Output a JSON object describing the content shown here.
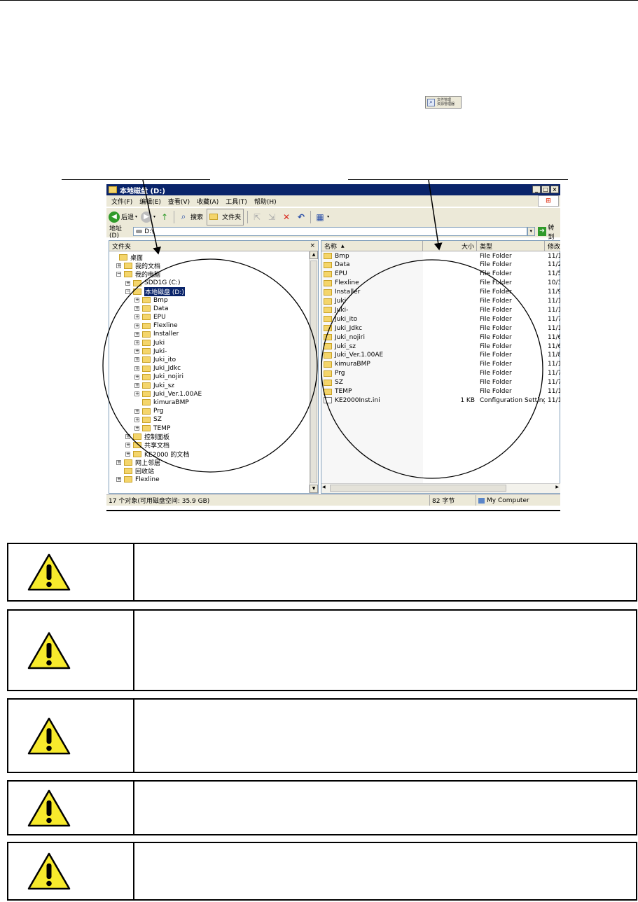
{
  "icon_button": {
    "line1": "文件管理",
    "line2": "资源管理器"
  },
  "window": {
    "title": "本地磁盘 (D:)",
    "menu": [
      "文件(F)",
      "编辑(E)",
      "查看(V)",
      "收藏(A)",
      "工具(T)",
      "帮助(H)"
    ],
    "toolbar": {
      "back": "后退",
      "search": "搜索",
      "folders": "文件夹"
    },
    "address": {
      "label": "地址(D)",
      "value": "D:\\",
      "go": "转到"
    },
    "left_pane": {
      "header": "文件夹",
      "close": "×",
      "tree": [
        {
          "label": "桌面",
          "level": 0,
          "expander": ""
        },
        {
          "label": "我的文档",
          "level": 1,
          "expander": "+"
        },
        {
          "label": "我的电脑",
          "level": 1,
          "expander": "−"
        },
        {
          "label": "SDD1G (C:)",
          "level": 2,
          "expander": "+"
        },
        {
          "label": "本地磁盘 (D:)",
          "level": 2,
          "expander": "−",
          "selected": true
        },
        {
          "label": "Bmp",
          "level": 3,
          "expander": "+"
        },
        {
          "label": "Data",
          "level": 3,
          "expander": "+"
        },
        {
          "label": "EPU",
          "level": 3,
          "expander": "+"
        },
        {
          "label": "Flexline",
          "level": 3,
          "expander": "+"
        },
        {
          "label": "Installer",
          "level": 3,
          "expander": "+"
        },
        {
          "label": "Juki",
          "level": 3,
          "expander": "+"
        },
        {
          "label": "Juki-",
          "level": 3,
          "expander": "+"
        },
        {
          "label": "Juki_ito",
          "level": 3,
          "expander": "+"
        },
        {
          "label": "Juki_Jdkc",
          "level": 3,
          "expander": "+"
        },
        {
          "label": "Juki_nojiri",
          "level": 3,
          "expander": "+"
        },
        {
          "label": "Juki_sz",
          "level": 3,
          "expander": "+"
        },
        {
          "label": "Juki_Ver.1.00AE",
          "level": 3,
          "expander": "+"
        },
        {
          "label": "kimuraBMP",
          "level": 3,
          "expander": ""
        },
        {
          "label": "Prg",
          "level": 3,
          "expander": "+"
        },
        {
          "label": "SZ",
          "level": 3,
          "expander": "+"
        },
        {
          "label": "TEMP",
          "level": 3,
          "expander": "+"
        },
        {
          "label": "控制面板",
          "level": 2,
          "expander": "+"
        },
        {
          "label": "共享文档",
          "level": 2,
          "expander": "+"
        },
        {
          "label": "KE2000 的文档",
          "level": 2,
          "expander": "+"
        },
        {
          "label": "网上邻居",
          "level": 1,
          "expander": "+"
        },
        {
          "label": "回收站",
          "level": 1,
          "expander": ""
        },
        {
          "label": "Flexline",
          "level": 1,
          "expander": "+"
        }
      ]
    },
    "right_pane": {
      "columns": [
        "名称",
        "大小",
        "类型",
        "修改"
      ],
      "rows": [
        {
          "name": "Bmp",
          "size": "",
          "type": "File Folder",
          "date": "11/1"
        },
        {
          "name": "Data",
          "size": "",
          "type": "File Folder",
          "date": "11/2"
        },
        {
          "name": "EPU",
          "size": "",
          "type": "File Folder",
          "date": "11/5"
        },
        {
          "name": "Flexline",
          "size": "",
          "type": "File Folder",
          "date": "10/3"
        },
        {
          "name": "Installer",
          "size": "",
          "type": "File Folder",
          "date": "11/9"
        },
        {
          "name": "Juki",
          "size": "",
          "type": "File Folder",
          "date": "11/1"
        },
        {
          "name": "Juki-",
          "size": "",
          "type": "File Folder",
          "date": "11/1"
        },
        {
          "name": "Juki_ito",
          "size": "",
          "type": "File Folder",
          "date": "11/7"
        },
        {
          "name": "Juki_Jdkc",
          "size": "",
          "type": "File Folder",
          "date": "11/1"
        },
        {
          "name": "Juki_nojiri",
          "size": "",
          "type": "File Folder",
          "date": "11/6"
        },
        {
          "name": "Juki_sz",
          "size": "",
          "type": "File Folder",
          "date": "11/6"
        },
        {
          "name": "Juki_Ver.1.00AE",
          "size": "",
          "type": "File Folder",
          "date": "11/8"
        },
        {
          "name": "kimuraBMP",
          "size": "",
          "type": "File Folder",
          "date": "11/1"
        },
        {
          "name": "Prg",
          "size": "",
          "type": "File Folder",
          "date": "11/7"
        },
        {
          "name": "SZ",
          "size": "",
          "type": "File Folder",
          "date": "11/7"
        },
        {
          "name": "TEMP",
          "size": "",
          "type": "File Folder",
          "date": "11/1"
        },
        {
          "name": "KE2000Inst.ini",
          "size": "1 KB",
          "type": "Configuration Settings",
          "date": "11/1"
        }
      ]
    },
    "status": {
      "objects": "17 个对象(可用磁盘空间: 35.9 GB)",
      "bytes": "82 字节",
      "location": "My Computer"
    }
  },
  "warning_boxes": [
    {
      "text": ""
    },
    {
      "text": ""
    },
    {
      "text": ""
    },
    {
      "text": ""
    },
    {
      "text": ""
    }
  ]
}
